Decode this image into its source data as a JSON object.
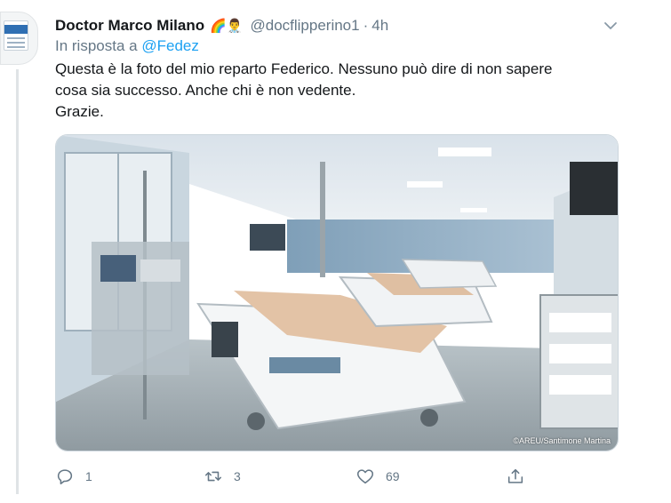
{
  "tweet": {
    "display_name": "Doctor Marco Milano",
    "name_emojis": "🌈👨‍⚕️",
    "handle": "@docflipperino1",
    "separator": "·",
    "time": "4h",
    "reply_prefix": "In risposta a",
    "reply_to": "@Fedez",
    "text_lines": [
      "Questa è la foto del mio reparto Federico. Nessuno può dire di non sapere",
      "cosa sia successo. Anche chi è non vedente.",
      "Grazie."
    ],
    "photo_credit": "©AREU/Santimone Martina",
    "counts": {
      "replies": "1",
      "retweets": "3",
      "likes": "69"
    }
  },
  "icons": {
    "more": "chevron-down-icon",
    "reply": "comment-bubble-icon",
    "retweet": "retweet-icon",
    "like": "heart-icon",
    "share": "share-upload-icon"
  },
  "colors": {
    "link": "#1da1f2",
    "secondary_text": "#657786",
    "primary_text": "#14171a",
    "thread_line": "#dfe3e6"
  }
}
